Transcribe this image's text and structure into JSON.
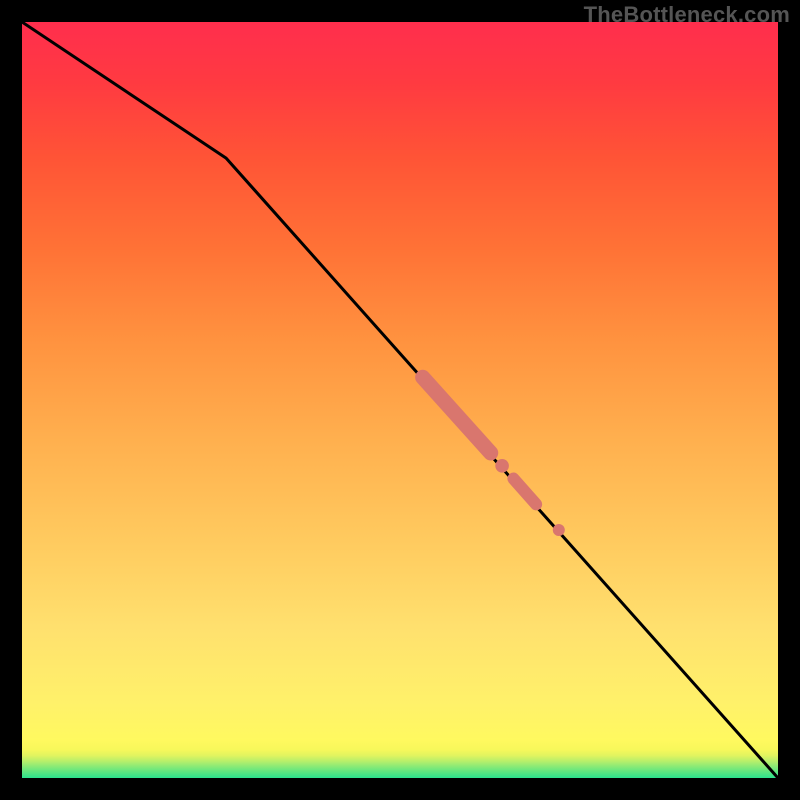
{
  "watermark": "TheBottleneck.com",
  "colors": {
    "frame": "#000000",
    "line": "#000000",
    "marker": "#d9766e",
    "gradient_stops": [
      "#2ce28d",
      "#7be97a",
      "#b6ef6b",
      "#e2f45f",
      "#f8f85b",
      "#fff95f",
      "#fff16a",
      "#ffe06e",
      "#ffc95e",
      "#ffaf4e",
      "#ff923f",
      "#ff7236",
      "#ff5436",
      "#ff3a41",
      "#ff2e4d"
    ]
  },
  "chart_data": {
    "type": "line",
    "title": "",
    "xlabel": "",
    "ylabel": "",
    "xlim": [
      0,
      100
    ],
    "ylim": [
      0,
      100
    ],
    "series": [
      {
        "name": "curve",
        "x": [
          0,
          27,
          100
        ],
        "y": [
          100,
          82,
          0
        ]
      }
    ],
    "markers": [
      {
        "shape": "segment",
        "x0": 53,
        "y0": 53,
        "x1": 62,
        "y1": 43,
        "width": 2.0
      },
      {
        "shape": "dot",
        "x": 63.5,
        "y": 41.3,
        "r": 0.9
      },
      {
        "shape": "segment",
        "x0": 65,
        "y0": 39.6,
        "x1": 68,
        "y1": 36.2,
        "width": 1.6
      },
      {
        "shape": "dot",
        "x": 71,
        "y": 32.8,
        "r": 0.8
      }
    ],
    "grid": false,
    "legend": false
  }
}
